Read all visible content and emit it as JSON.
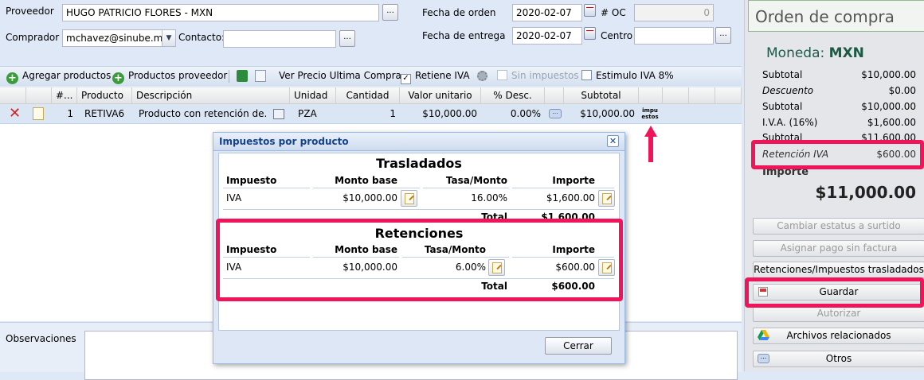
{
  "header": {
    "proveedor_label": "Proveedor",
    "proveedor_value": "HUGO PATRICIO FLORES - MXN",
    "comprador_label": "Comprador",
    "comprador_value": "mchavez@sinube.m",
    "contacto_label": "Contacto:",
    "contacto_value": "",
    "more_label": "...",
    "fecha_orden_label": "Fecha de orden",
    "fecha_orden_value": "2020-02-07",
    "num_oc_label": "# OC",
    "num_oc_value": "0",
    "fecha_entrega_label": "Fecha de entrega",
    "fecha_entrega_value": "2020-02-07",
    "centro_label": "Centro",
    "centro_value": ""
  },
  "toolbar": {
    "agregar_productos": "Agregar productos",
    "productos_proveedor": "Productos proveedor",
    "ver_precio": "Ver Precio Ultima Compra",
    "retiene_iva": "Retiene IVA",
    "retiene_iva_checked": true,
    "sin_impuestos": "Sin impuestos",
    "estimulo_iva": "Estimulo IVA 8%"
  },
  "grid": {
    "headers": [
      "#...",
      "Producto",
      "Descripción",
      "Unidad",
      "Cantidad",
      "Valor unitario",
      "% Desc.",
      "Subtotal"
    ],
    "row": {
      "num": "1",
      "producto": "RETIVA6",
      "descripcion": "Producto con retención de...",
      "unidad": "PZA",
      "cantidad": "1",
      "valor_unitario": "$10,000.00",
      "descuento": "0.00%",
      "subtotal": "$10,000.00",
      "impuestos_icon_text": "impu estos"
    }
  },
  "observaciones_label": "Observaciones",
  "right_panel": {
    "title": "Orden de compra",
    "moneda_label": "Moneda:",
    "moneda_value": "MXN",
    "totals": [
      {
        "label": "Subtotal",
        "value": "$10,000.00"
      },
      {
        "label": "Descuento",
        "value": "$0.00"
      },
      {
        "label": "Subtotal",
        "value": "$10,000.00"
      },
      {
        "label": "I.V.A. (16%)",
        "value": "$1,600.00"
      },
      {
        "label": "Subtotal",
        "value": "$11,600.00"
      },
      {
        "label": "Retención IVA",
        "value": "$600.00"
      }
    ],
    "importe_label": "Importe",
    "importe_value": "$11,000.00",
    "buttons": {
      "cambiar_estatus": "Cambiar estatus a surtido",
      "asignar_pago": "Asignar pago sin factura",
      "retenciones": "Retenciones/Impuestos trasladados",
      "guardar": "Guardar",
      "autorizar": "Autorizar",
      "archivos": "Archivos relacionados",
      "otros": "Otros"
    }
  },
  "dialog": {
    "title": "Impuestos por producto",
    "close_label": "Cerrar",
    "trasladados": {
      "title": "Trasladados",
      "headers": [
        "Impuesto",
        "Monto base",
        "Tasa/Monto",
        "Importe"
      ],
      "row": {
        "impuesto": "IVA",
        "monto_base": "$10,000.00",
        "tasa": "16.00%",
        "importe": "$1,600.00"
      },
      "total_label": "Total",
      "total_value": "$1,600.00"
    },
    "retenciones": {
      "title": "Retenciones",
      "headers": [
        "Impuesto",
        "Monto base",
        "Tasa/Monto",
        "Importe"
      ],
      "row": {
        "impuesto": "IVA",
        "monto_base": "$10,000.00",
        "tasa": "6.00%",
        "importe": "$600.00"
      },
      "total_label": "Total",
      "total_value": "$600.00"
    }
  },
  "colors": {
    "highlight": "#f0145a",
    "panel_bg": "#dfe8f6",
    "grid_row": "#dbe6f4"
  }
}
